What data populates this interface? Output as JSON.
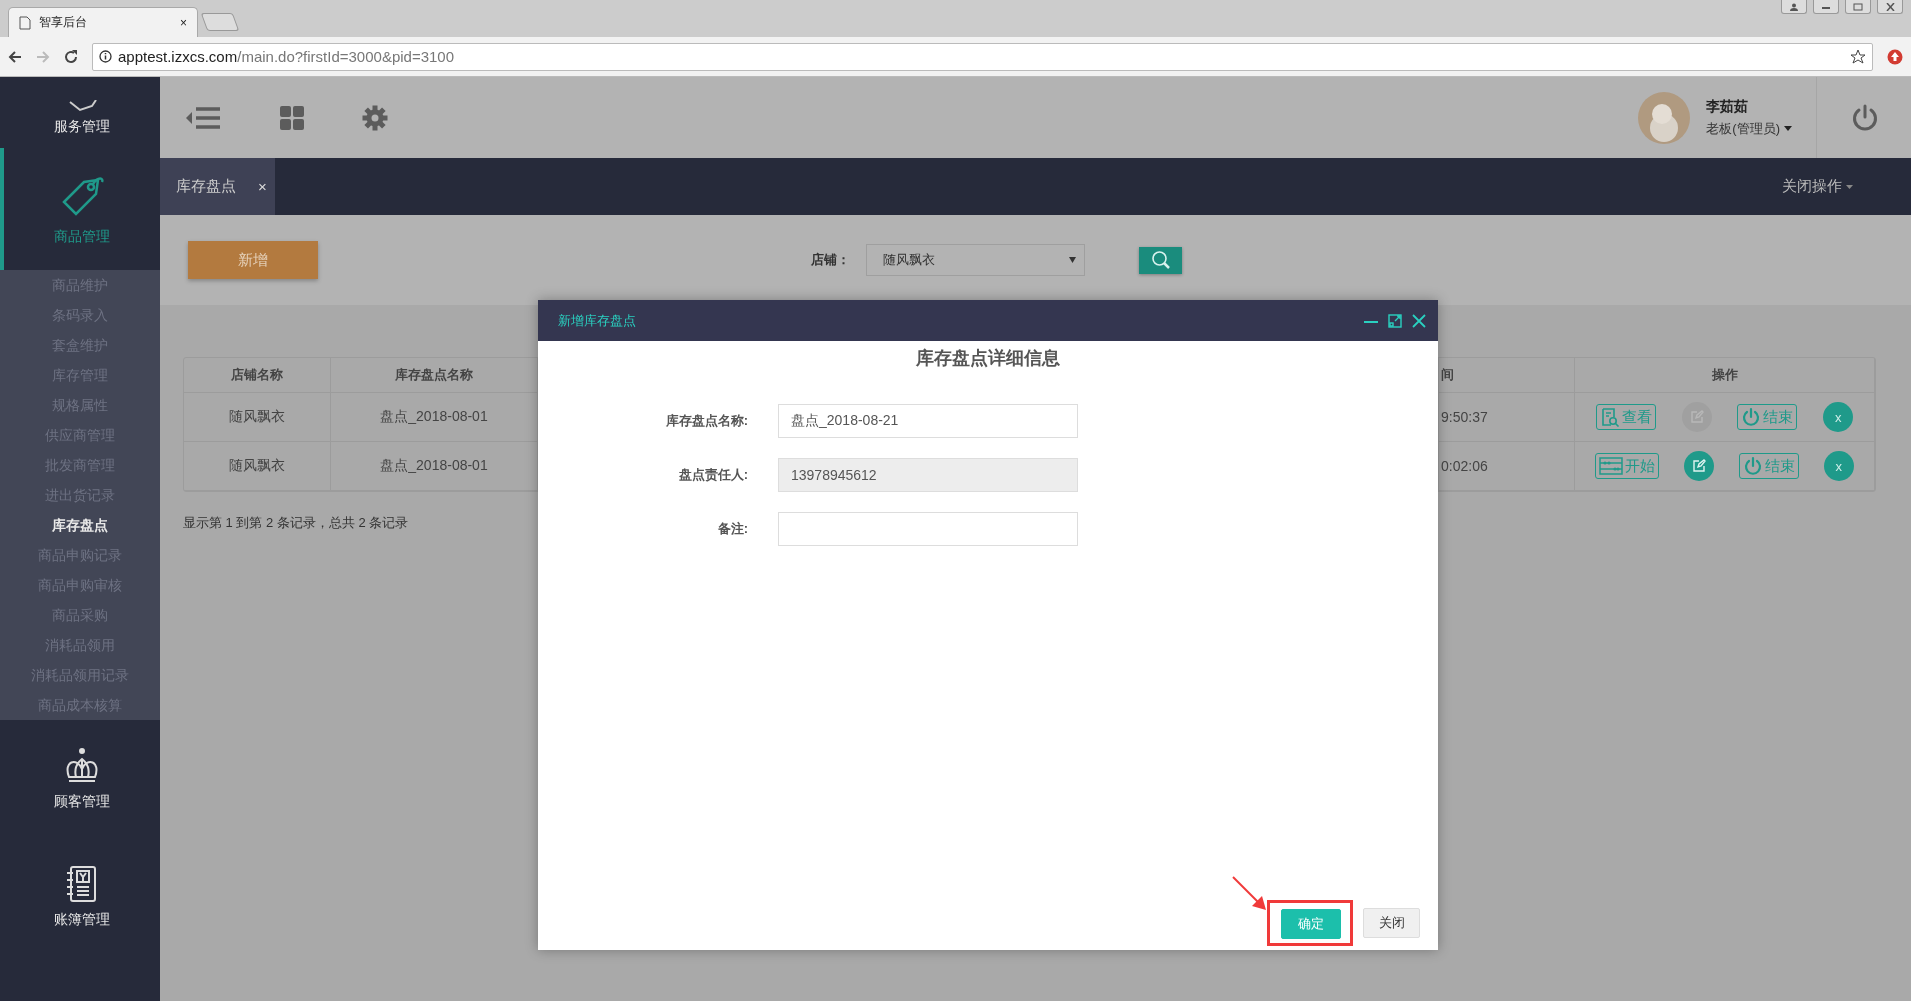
{
  "browser": {
    "tab": {
      "title": "智享后台",
      "close": "×"
    },
    "url_host": "apptest.izxcs.com",
    "url_path": "/main.do?firstId=3000&pid=3100"
  },
  "sidebar": {
    "groups": [
      {
        "kind": "service",
        "label": "服务管理",
        "selected": false
      },
      {
        "kind": "goods",
        "label": "商品管理",
        "selected": true,
        "children": [
          {
            "label": "商品维护",
            "selected": false
          },
          {
            "label": "条码录入",
            "selected": false
          },
          {
            "label": "套盒维护",
            "selected": false
          },
          {
            "label": "库存管理",
            "selected": false
          },
          {
            "label": "规格属性",
            "selected": false
          },
          {
            "label": "供应商管理",
            "selected": false
          },
          {
            "label": "批发商管理",
            "selected": false
          },
          {
            "label": "进出货记录",
            "selected": false
          },
          {
            "label": "库存盘点",
            "selected": true
          },
          {
            "label": "商品申购记录",
            "selected": false
          },
          {
            "label": "商品申购审核",
            "selected": false
          },
          {
            "label": "商品采购",
            "selected": false
          },
          {
            "label": "消耗品领用",
            "selected": false
          },
          {
            "label": "消耗品领用记录",
            "selected": false
          },
          {
            "label": "商品成本核算",
            "selected": false
          }
        ]
      },
      {
        "kind": "customer",
        "label": "顾客管理",
        "selected": false
      },
      {
        "kind": "ledger",
        "label": "账簿管理",
        "selected": false
      }
    ]
  },
  "header": {
    "user": {
      "name": "李茹茹",
      "role": "老板(管理员)"
    }
  },
  "tabs": [
    {
      "label": "库存盘点",
      "close": "×",
      "selected": true
    }
  ],
  "close_ops": "关闭操作",
  "toolbar": {
    "add": "新增",
    "store_label": "店铺：",
    "store_value": "随风飘衣"
  },
  "table": {
    "columns": [
      "店铺名称",
      "库存盘点名称",
      "间",
      "操作"
    ],
    "rows": [
      {
        "cells": [
          "随风飘衣",
          "盘点_2018-08-01",
          "9:50:37"
        ],
        "actions": [
          {
            "kind": "view",
            "label": "查看"
          },
          {
            "kind": "edit",
            "disabled": true
          },
          {
            "kind": "end",
            "label": "结束"
          },
          {
            "kind": "delete",
            "label": "x"
          }
        ]
      },
      {
        "cells": [
          "随风飘衣",
          "盘点_2018-08-01",
          "0:02:06"
        ],
        "actions": [
          {
            "kind": "start",
            "label": "开始"
          },
          {
            "kind": "edit",
            "disabled": false
          },
          {
            "kind": "end",
            "label": "结束"
          },
          {
            "kind": "delete",
            "label": "x"
          }
        ]
      }
    ]
  },
  "footer": "显示第 1 到第 2 条记录，总共 2 条记录",
  "dialog": {
    "title": "新增库存盘点",
    "heading": "库存盘点详细信息",
    "fields": [
      {
        "label": "库存盘点名称:",
        "value": "盘点_2018-08-21",
        "disabled": false
      },
      {
        "label": "盘点责任人:",
        "value": "13978945612",
        "disabled": true
      },
      {
        "label": "备注:",
        "disabled": false
      }
    ],
    "buttons": [
      {
        "label": "确定",
        "kind": "primary",
        "highlighted": true
      },
      {
        "label": "关闭",
        "kind": "default",
        "highlighted": false
      }
    ]
  }
}
